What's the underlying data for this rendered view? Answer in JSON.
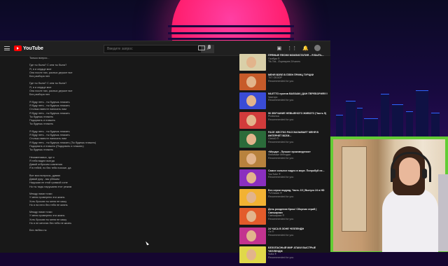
{
  "youtube": {
    "logo_text": "YouTube",
    "search_placeholder": "Введите запрос",
    "lyrics_top": "Только вопрос...",
    "lyrics": [
      "Где ты была? С кем ты была?",
      "Я, я и сердце мое",
      "Она после них, разных держит все",
      "Без разбора пел",
      "",
      "Где ты была? С кем ты была?",
      "Я, я и сердце мое",
      "Она после них, разных держит все",
      "Без разбора пел",
      "",
      "Я буду петь - ты будешь плакать",
      "Я буду петь - ты будешь плакать",
      "Столько вместе написать нам",
      "Я буду петь - ты будешь плакать",
      "Ты будешь плакать",
      "Подорвать и плакать",
      "Ты будешь плакать",
      "",
      "Я буду петь - ты будешь плакать",
      "Я буду петь - ты будешь плакать",
      "Столько вместе написать нам",
      "Я буду петь - ты будешь плакать (Ты будешь плакать)",
      "Подорвать и плакать (Подорвать и плакать)",
      "Ты будешь плакать",
      "",
      "Незаменимых, где я",
      "Я тебя видел всегда",
      "Давай отбросим сомнения",
      "Я в тебей, но без тебя похоже, да",
      "",
      "Все мои вопросы, думаю",
      "Давай руку - мы убежим",
      "Нарушая ее этой громкой соне",
      "Но ты тиды нарушаем этот режим",
      "",
      "Между нами точки",
      "У меня проверено эти жизнь",
      "Хоть бросаю ты меня не кашу",
      "Но я на него без тебя не жизнь",
      "",
      "Между нами точки",
      "У меня проверено эти жизнь",
      "Хоть бросаю ты меня не кашу",
      "Но я не мечтаю без тебя не жизнь",
      "",
      "Без любви-ты"
    ],
    "videos": [
      {
        "title": "ПРЯНЫЕ ПЕСНИ МОИЗИСТАТИЯ – Я БЫТЬ...",
        "channel": "Палбум ®",
        "meta": "Tik-Tok, -Ещевзрев 2/Ivanes",
        "thumb": "#d9cfa8"
      },
      {
        "title": "МЕНЯ ВЗЯЛ В ПЛЕН ПРИНЦ ТУРЦИИ",
        "channel": "ТКТ ОБЗОР",
        "meta": "Recommended for you",
        "thumb": "#c75b2a"
      },
      {
        "title": "NILETTO против BASSAM | ДАН ПЕРЕБОРИЯ!!!!",
        "channel": "Чикторс",
        "meta": "Recommended for you",
        "thumb": "#3a4cd6"
      },
      {
        "title": "50 ЗВУЧАНИЕ НЕВЫЕНОГО ЖИВОГО (Часть 5)",
        "channel": "Pixibsrtoa",
        "meta": "Recommended for you",
        "thumb": "#d13b3b"
      },
      {
        "title": "FACE ЖЕСТКО РАССКАЗЫВАЕТ МЕНЯ В ИНТЕРНЕТ ВСЕИ...",
        "channel": "Gleb40 ®",
        "meta": "Recommended for you",
        "thumb": "#2b6b3a"
      },
      {
        "title": "«Моцарт - Лучшие произведения»",
        "channel": "Любимые Мелодии",
        "meta": "Recommended for you",
        "thumb": "#b8823d"
      },
      {
        "title": "Самое сильное видео в мире. Попробуй не...",
        "channel": "YouTube ®",
        "meta": "Recommended for you",
        "thumb": "#8a2fbf"
      },
      {
        "title": "Без серии подряд, Часть 15 | Выпуск 24 в HD",
        "channel": "TVClassic ®",
        "meta": "Recommended for you",
        "thumb": "#f2b233"
      },
      {
        "title": "День рождения Крош! Сборник серий | Смешарики",
        "channel": "Смешарики ®",
        "meta": "Recommended for you",
        "thumb": "#e35b2a"
      },
      {
        "title": "24 ЧАСА В ЗОНЕ ЧЕЛЛЕНДЖ",
        "channel": "Ox ®",
        "meta": "Recommended for you",
        "thumb": "#c3338f"
      },
      {
        "title": "БЕЗОПАСНЫЙ МИР АТАКИ БЫСТРЫЕ ЧЕЛЛЕНДЖ",
        "channel": "Sofia ®",
        "meta": "Recommended for you",
        "thumb": "#e0d84a"
      }
    ]
  },
  "colors": {
    "youtube_red": "#ff0000",
    "webcam_border": "#62cc34",
    "sun": "#ff2a86"
  }
}
